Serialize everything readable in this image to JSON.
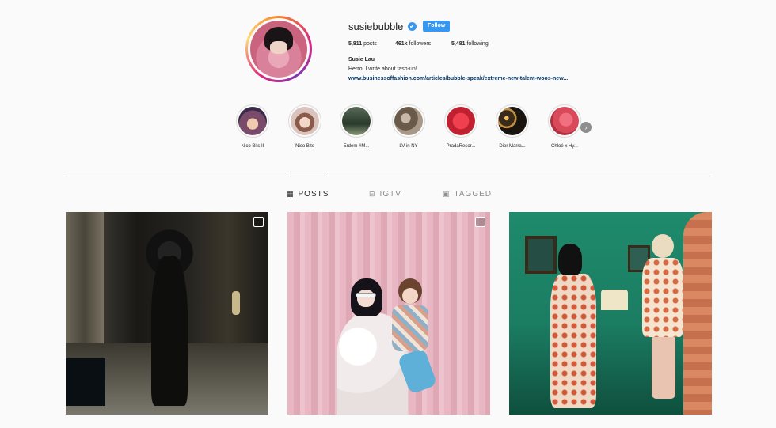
{
  "profile": {
    "username": "susiebubble",
    "verified_icon": "✔",
    "follow_label": "Follow",
    "posts_count": "5,811",
    "posts_label": "posts",
    "followers_count": "461k",
    "followers_label": "followers",
    "following_count": "5,481",
    "following_label": "following",
    "full_name": "Susie Lau",
    "bio": "Herro! I write about fash-un!",
    "link": "www.businessoffashion.com/articles/bubble-speak/extreme-new-talent-woos-new..."
  },
  "highlights": [
    {
      "label": "Nico Bits II",
      "color": "#7a4a6a"
    },
    {
      "label": "Nico Bits",
      "color": "#c9a49a"
    },
    {
      "label": "Erdem #M...",
      "color": "#3a4a3a"
    },
    {
      "label": "LV in NY",
      "color": "#8a7a6a"
    },
    {
      "label": "PradaResor...",
      "color": "#e03040"
    },
    {
      "label": "Dior Marra...",
      "color": "#3a2a1a"
    },
    {
      "label": "Chloé x Hy...",
      "color": "#d84a5a"
    }
  ],
  "highlights_next_icon": "›",
  "tabs": {
    "posts": {
      "label": "POSTS",
      "icon": "▦"
    },
    "igtv": {
      "label": "IGTV",
      "icon": "⊟"
    },
    "tagged": {
      "label": "TAGGED",
      "icon": "▣"
    }
  },
  "colors": {
    "accent": "#3897f0",
    "link": "#003569",
    "background": "#fafafa"
  }
}
